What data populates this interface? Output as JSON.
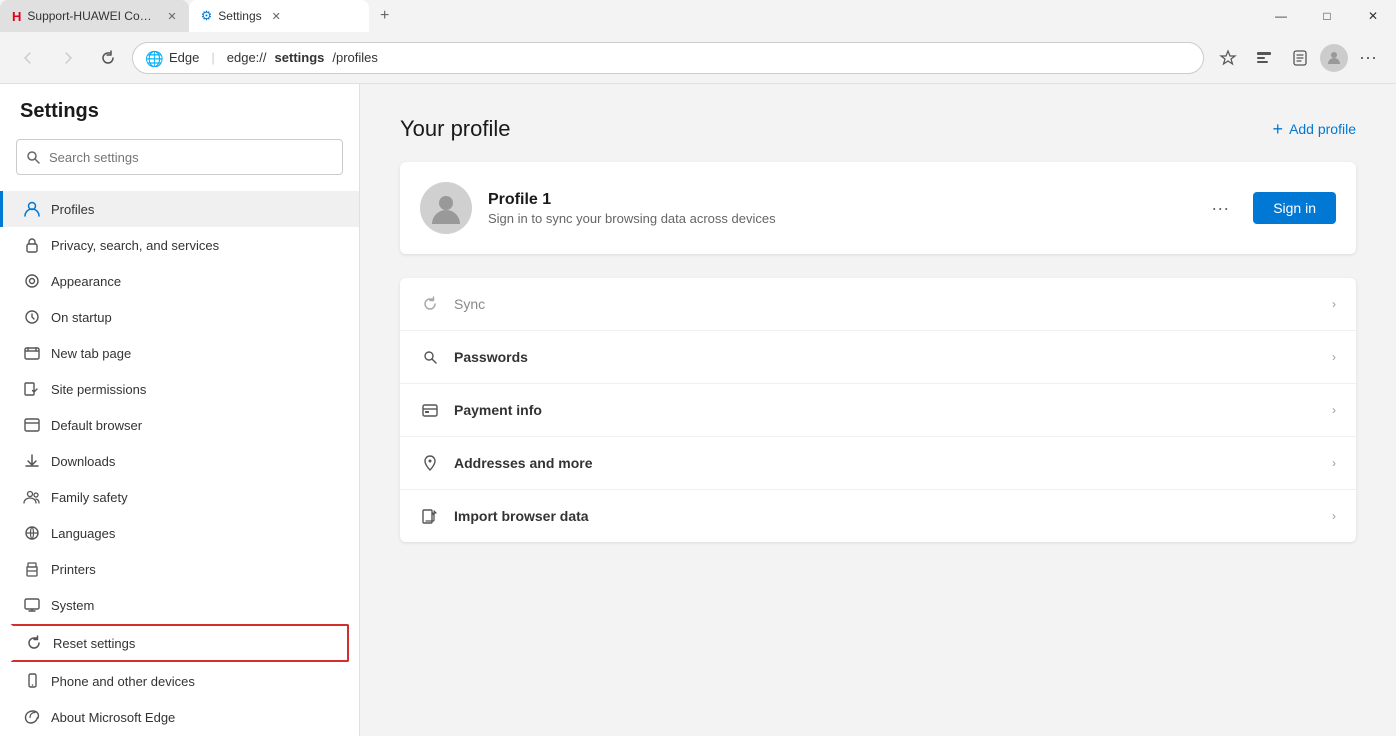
{
  "window": {
    "tabs": [
      {
        "id": "tab1",
        "title": "Support-HUAWEI Consumer Off...",
        "active": false,
        "favicon": "huawei"
      },
      {
        "id": "tab2",
        "title": "Settings",
        "active": true,
        "favicon": "settings"
      }
    ],
    "controls": {
      "minimize": "—",
      "maximize": "□",
      "close": "✕"
    }
  },
  "addressbar": {
    "back": "←",
    "forward": "→",
    "reload": "↻",
    "browser_name": "Edge",
    "separator": "|",
    "url_prefix": "edge://",
    "url_path": "settings",
    "url_suffix": "/profiles",
    "new_tab": "+"
  },
  "sidebar": {
    "title": "Settings",
    "search_placeholder": "Search settings",
    "items": [
      {
        "id": "profiles",
        "label": "Profiles",
        "active": true
      },
      {
        "id": "privacy",
        "label": "Privacy, search, and services",
        "active": false
      },
      {
        "id": "appearance",
        "label": "Appearance",
        "active": false
      },
      {
        "id": "on-startup",
        "label": "On startup",
        "active": false
      },
      {
        "id": "new-tab",
        "label": "New tab page",
        "active": false
      },
      {
        "id": "site-permissions",
        "label": "Site permissions",
        "active": false
      },
      {
        "id": "default-browser",
        "label": "Default browser",
        "active": false
      },
      {
        "id": "downloads",
        "label": "Downloads",
        "active": false
      },
      {
        "id": "family-safety",
        "label": "Family safety",
        "active": false
      },
      {
        "id": "languages",
        "label": "Languages",
        "active": false
      },
      {
        "id": "printers",
        "label": "Printers",
        "active": false
      },
      {
        "id": "system",
        "label": "System",
        "active": false
      },
      {
        "id": "reset-settings",
        "label": "Reset settings",
        "active": false,
        "highlighted": true
      },
      {
        "id": "phone-devices",
        "label": "Phone and other devices",
        "active": false
      },
      {
        "id": "about-edge",
        "label": "About Microsoft Edge",
        "active": false
      }
    ]
  },
  "content": {
    "title": "Your profile",
    "add_profile_label": "Add profile",
    "profile": {
      "name": "Profile 1",
      "description": "Sign in to sync your browsing data across devices",
      "sign_in_label": "Sign in"
    },
    "settings_rows": [
      {
        "id": "sync",
        "label": "Sync",
        "bold": false,
        "gray": true
      },
      {
        "id": "passwords",
        "label": "Passwords",
        "bold": true,
        "gray": false
      },
      {
        "id": "payment-info",
        "label": "Payment info",
        "bold": true,
        "gray": false
      },
      {
        "id": "addresses",
        "label": "Addresses and more",
        "bold": true,
        "gray": false
      },
      {
        "id": "import",
        "label": "Import browser data",
        "bold": true,
        "gray": false
      }
    ]
  }
}
